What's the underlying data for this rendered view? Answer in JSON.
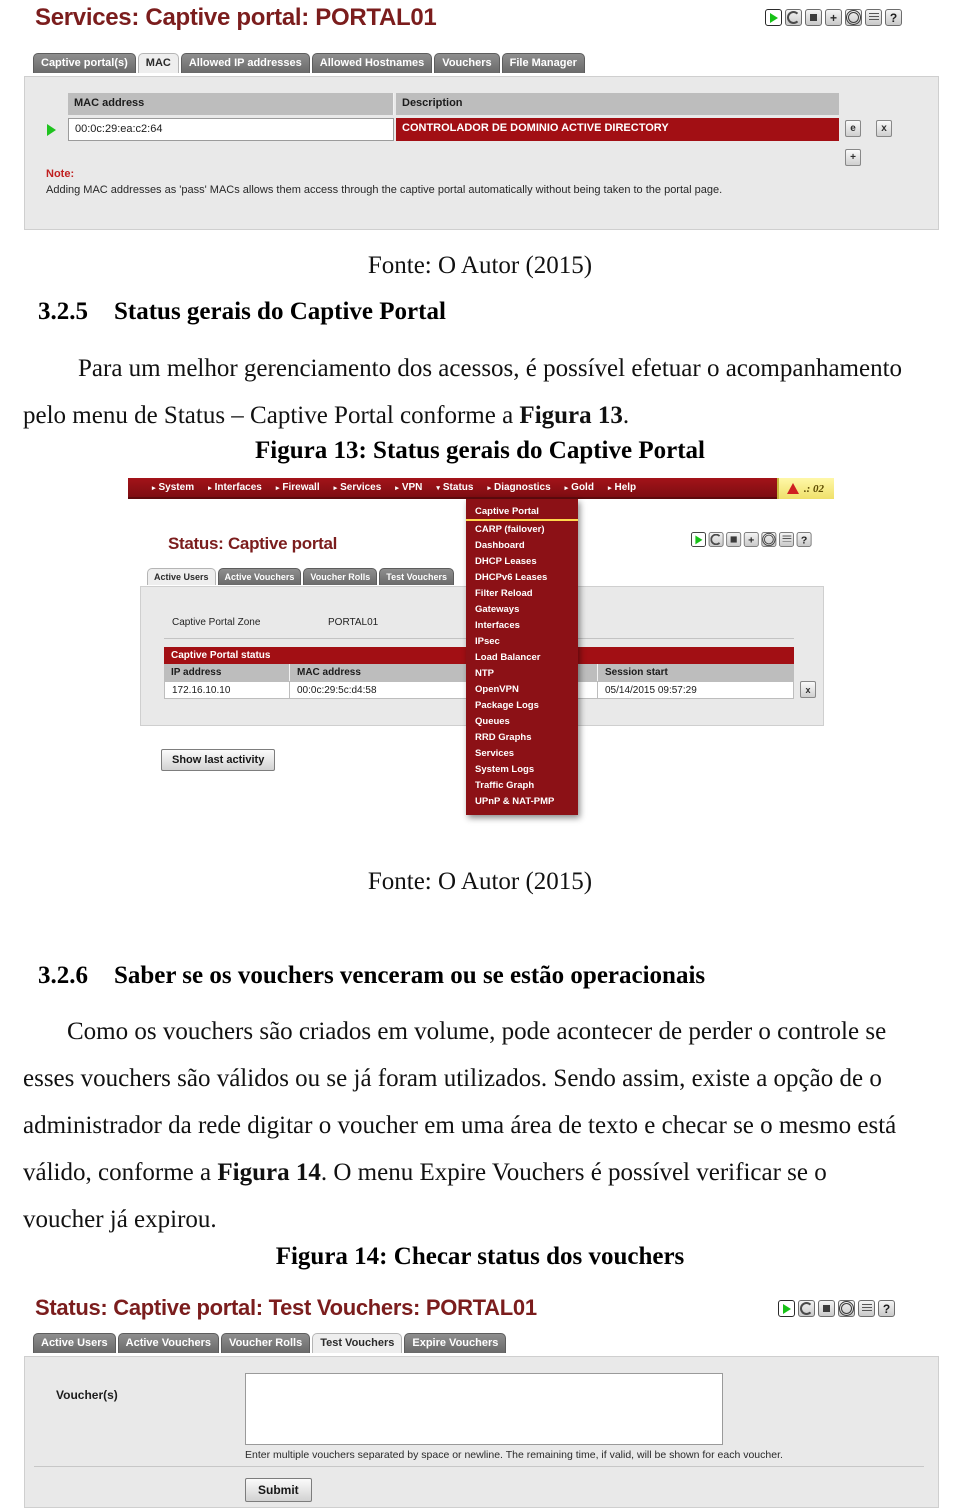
{
  "figure12": {
    "title": "Services: Captive portal: PORTAL01",
    "icons": [
      "play-icon",
      "restart-icon",
      "stop-icon",
      "add-icon",
      "gear-icon",
      "log-icon",
      "help-icon"
    ],
    "tabs": [
      {
        "label": "Captive portal(s)",
        "active": false
      },
      {
        "label": "MAC",
        "active": true
      },
      {
        "label": "Allowed IP addresses",
        "active": false
      },
      {
        "label": "Allowed Hostnames",
        "active": false
      },
      {
        "label": "Vouchers",
        "active": false
      },
      {
        "label": "File Manager",
        "active": false
      }
    ],
    "table": {
      "headers": [
        "MAC address",
        "Description"
      ],
      "rows": [
        {
          "mac": "00:0c:29:ea:c2:64",
          "description": "CONTROLADOR DE DOMINIO ACTIVE DIRECTORY"
        }
      ],
      "row_actions": [
        "edit-icon",
        "delete-icon"
      ],
      "table_actions": [
        "add-row-icon"
      ]
    },
    "note_title": "Note:",
    "note_body": "Adding MAC addresses as 'pass' MACs allows them access through the captive portal automatically without being taken to the portal page."
  },
  "source1": "Fonte: O Autor (2015)",
  "section_325": {
    "number": "3.2.5",
    "title": "Status gerais do Captive Portal",
    "paragraph_a": "Para um melhor gerenciamento dos acessos, é possível efetuar o acompanhamento",
    "paragraph_b_pre": "pelo menu de Status – Captive Portal conforme a ",
    "paragraph_b_bold": "Figura 13",
    "paragraph_b_post": "."
  },
  "figure13_caption": "Figura 13: Status gerais do Captive Portal",
  "figure13": {
    "nav": [
      {
        "label": "System",
        "caret": "▸"
      },
      {
        "label": "Interfaces",
        "caret": "▸"
      },
      {
        "label": "Firewall",
        "caret": "▸"
      },
      {
        "label": "Services",
        "caret": "▸"
      },
      {
        "label": "VPN",
        "caret": "▸"
      },
      {
        "label": "Status",
        "caret": "▾"
      },
      {
        "label": "Diagnostics",
        "caret": "▸"
      },
      {
        "label": "Gold",
        "caret": "▸"
      },
      {
        "label": "Help",
        "caret": "▸"
      }
    ],
    "alert_badge": ".: 02",
    "dropdown": [
      {
        "label": "Captive Portal",
        "selected": true
      },
      {
        "label": "CARP (failover)",
        "selected": false
      },
      {
        "label": "Dashboard",
        "selected": false
      },
      {
        "label": "DHCP Leases",
        "selected": false
      },
      {
        "label": "DHCPv6 Leases",
        "selected": false
      },
      {
        "label": "Filter Reload",
        "selected": false
      },
      {
        "label": "Gateways",
        "selected": false
      },
      {
        "label": "Interfaces",
        "selected": false
      },
      {
        "label": "IPsec",
        "selected": false
      },
      {
        "label": "Load Balancer",
        "selected": false
      },
      {
        "label": "NTP",
        "selected": false
      },
      {
        "label": "OpenVPN",
        "selected": false
      },
      {
        "label": "Package Logs",
        "selected": false
      },
      {
        "label": "Queues",
        "selected": false
      },
      {
        "label": "RRD Graphs",
        "selected": false
      },
      {
        "label": "Services",
        "selected": false
      },
      {
        "label": "System Logs",
        "selected": false
      },
      {
        "label": "Traffic Graph",
        "selected": false
      },
      {
        "label": "UPnP & NAT-PMP",
        "selected": false
      }
    ],
    "title": "Status: Captive portal",
    "icons": [
      "play-icon",
      "restart-icon",
      "stop-icon",
      "add-icon",
      "gear-icon",
      "log-icon",
      "help-icon"
    ],
    "tabs": [
      {
        "label": "Active Users",
        "active": true
      },
      {
        "label": "Active Vouchers",
        "active": false
      },
      {
        "label": "Voucher Rolls",
        "active": false
      },
      {
        "label": "Test Vouchers",
        "active": false
      }
    ],
    "zone_label": "Captive Portal Zone",
    "zone_value": "PORTAL01",
    "status_bar": "Captive Portal status",
    "table": {
      "headers": [
        "IP address",
        "MAC address",
        "Session start"
      ],
      "rows": [
        {
          "ip": "172.16.10.10",
          "mac": "00:0c:29:5c:d4:58",
          "session_start": "05/14/2015 09:57:29"
        }
      ],
      "row_action": "disconnect-icon"
    },
    "button": "Show last activity"
  },
  "source2": "Fonte: O Autor (2015)",
  "section_326": {
    "number": "3.2.6",
    "title": "Saber se os vouchers venceram ou se estão operacionais",
    "line1": "Como os vouchers são criados em volume, pode acontecer de perder o controle se",
    "line2": "esses vouchers são válidos ou se já foram utilizados. Sendo assim, existe a opção de o",
    "line3": "administrador da rede digitar o voucher em uma área de texto e checar se o mesmo está",
    "line4_pre": "válido, conforme a ",
    "line4_bold": "Figura 14",
    "line4_post": ". O menu Expire Vouchers é possível verificar se o",
    "line5": "voucher já expirou."
  },
  "figure14_caption": "Figura 14: Checar status dos vouchers",
  "figure14": {
    "title": "Status: Captive portal: Test Vouchers: PORTAL01",
    "icons": [
      "play-icon",
      "restart-icon",
      "stop-icon",
      "gear-icon",
      "log-icon",
      "help-icon"
    ],
    "tabs": [
      {
        "label": "Active Users",
        "active": false
      },
      {
        "label": "Active Vouchers",
        "active": false
      },
      {
        "label": "Voucher Rolls",
        "active": false
      },
      {
        "label": "Test Vouchers",
        "active": true
      },
      {
        "label": "Expire Vouchers",
        "active": false
      }
    ],
    "field_label": "Voucher(s)",
    "field_value": "",
    "hint": "Enter multiple vouchers separated by space or newline. The remaining time, if valid, will be shown for each voucher.",
    "submit": "Submit"
  },
  "colors": {
    "brand_red": "#a20f14",
    "title_red": "#7b1d1d",
    "nav_red": "#8c1116",
    "panel_gray": "#e9e9e9",
    "header_gray": "#bdbdbd",
    "accent_yellow": "#ffd84d"
  }
}
